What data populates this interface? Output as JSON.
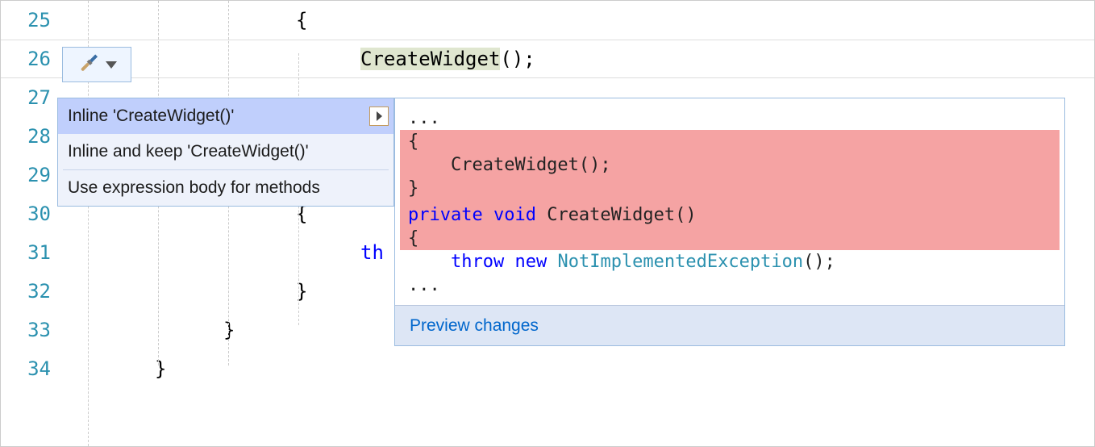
{
  "line_numbers": [
    "25",
    "26",
    "27",
    "28",
    "29",
    "30",
    "31",
    "32",
    "33",
    "34"
  ],
  "code": {
    "l25": "{",
    "l26_hl": "CreateWidget",
    "l26_rest": "();",
    "l30": "{",
    "l31_kw": "th",
    "l32": "}",
    "l33": "}",
    "l34": "}"
  },
  "qa": {
    "items": [
      "Inline 'CreateWidget()'",
      "Inline and keep 'CreateWidget()'",
      "Use expression body for methods"
    ]
  },
  "preview": {
    "l1": "...",
    "l2": "{",
    "l3": "    CreateWidget();",
    "l4": "}",
    "l5": "",
    "l6_kw1": "private",
    "l6_kw2": "void",
    "l6_rest": " CreateWidget()",
    "l7": "{",
    "l8_kw1": "throw",
    "l8_kw2": "new",
    "l8_type": "NotImplementedException",
    "l8_rest": "();",
    "l9": "...",
    "footer": "Preview changes"
  }
}
